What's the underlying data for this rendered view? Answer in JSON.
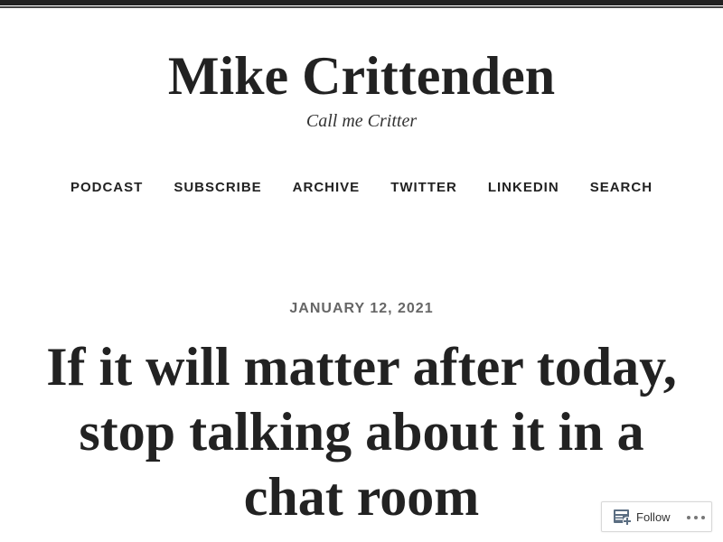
{
  "site": {
    "title": "Mike Crittenden",
    "tagline": "Call me Critter"
  },
  "nav": {
    "items": [
      {
        "label": "PODCAST"
      },
      {
        "label": "SUBSCRIBE"
      },
      {
        "label": "ARCHIVE"
      },
      {
        "label": "TWITTER"
      },
      {
        "label": "LINKEDIN"
      },
      {
        "label": "SEARCH"
      }
    ]
  },
  "post": {
    "date": "JANUARY 12, 2021",
    "title": "If it will matter after today, stop talking about it in a chat room"
  },
  "follow_widget": {
    "follow_label": "Follow",
    "follow_icon": "reader-follow-icon",
    "more_icon": "ellipsis-icon"
  },
  "colors": {
    "text": "#222222",
    "date": "#666666",
    "top_bar": "#222222"
  }
}
